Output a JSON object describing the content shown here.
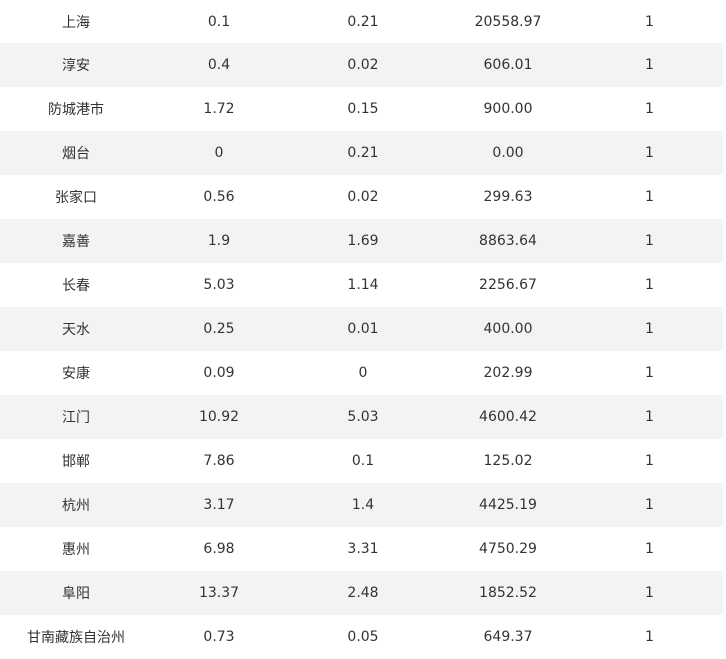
{
  "rows": [
    {
      "city": "上海",
      "v1": "0.1",
      "v2": "0.21",
      "v3": "20558.97",
      "v4": "1"
    },
    {
      "city": "淳安",
      "v1": "0.4",
      "v2": "0.02",
      "v3": "606.01",
      "v4": "1"
    },
    {
      "city": "防城港市",
      "v1": "1.72",
      "v2": "0.15",
      "v3": "900.00",
      "v4": "1"
    },
    {
      "city": "烟台",
      "v1": "0",
      "v2": "0.21",
      "v3": "0.00",
      "v4": "1"
    },
    {
      "city": "张家口",
      "v1": "0.56",
      "v2": "0.02",
      "v3": "299.63",
      "v4": "1"
    },
    {
      "city": "嘉善",
      "v1": "1.9",
      "v2": "1.69",
      "v3": "8863.64",
      "v4": "1"
    },
    {
      "city": "长春",
      "v1": "5.03",
      "v2": "1.14",
      "v3": "2256.67",
      "v4": "1"
    },
    {
      "city": "天水",
      "v1": "0.25",
      "v2": "0.01",
      "v3": "400.00",
      "v4": "1"
    },
    {
      "city": "安康",
      "v1": "0.09",
      "v2": "0",
      "v3": "202.99",
      "v4": "1"
    },
    {
      "city": "江门",
      "v1": "10.92",
      "v2": "5.03",
      "v3": "4600.42",
      "v4": "1"
    },
    {
      "city": "邯郸",
      "v1": "7.86",
      "v2": "0.1",
      "v3": "125.02",
      "v4": "1"
    },
    {
      "city": "杭州",
      "v1": "3.17",
      "v2": "1.4",
      "v3": "4425.19",
      "v4": "1"
    },
    {
      "city": "惠州",
      "v1": "6.98",
      "v2": "3.31",
      "v3": "4750.29",
      "v4": "1"
    },
    {
      "city": "阜阳",
      "v1": "13.37",
      "v2": "2.48",
      "v3": "1852.52",
      "v4": "1"
    },
    {
      "city": "甘南藏族自治州",
      "v1": "0.73",
      "v2": "0.05",
      "v3": "649.37",
      "v4": "1"
    }
  ]
}
